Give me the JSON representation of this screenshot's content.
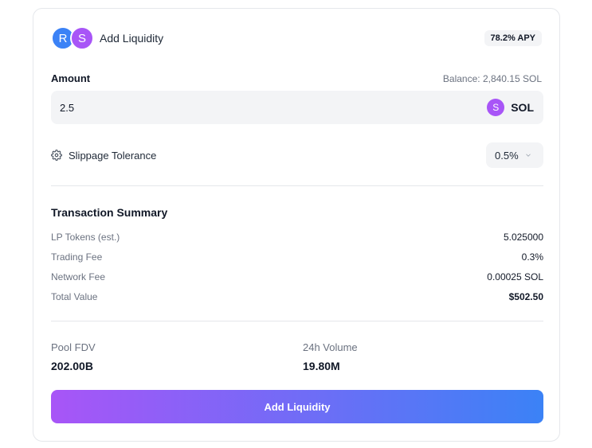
{
  "header": {
    "token_a_letter": "R",
    "token_b_letter": "S",
    "title": "Add Liquidity",
    "apy_badge": "78.2% APY",
    "token_a_color": "#3b82f6",
    "token_b_color": "#a855f7"
  },
  "amount": {
    "label": "Amount",
    "balance": "Balance: 2,840.15 SOL",
    "value": "2.5",
    "token_letter": "S",
    "token_symbol": "SOL"
  },
  "slippage": {
    "icon": "gear-icon",
    "label": "Slippage Tolerance",
    "selected": "0.5%",
    "dropdown_icon": "chevron-down-icon"
  },
  "summary": {
    "title": "Transaction Summary",
    "rows": [
      {
        "label": "LP Tokens (est.)",
        "value": "5.025000"
      },
      {
        "label": "Trading Fee",
        "value": "0.3%"
      },
      {
        "label": "Network Fee",
        "value": "0.00025 SOL"
      },
      {
        "label": "Total Value",
        "value": "$502.50"
      }
    ]
  },
  "stats": {
    "pool_fdv_label": "Pool FDV",
    "pool_fdv_value": "202.00B",
    "volume_label": "24h Volume",
    "volume_value": "19.80M"
  },
  "cta": {
    "label": "Add Liquidity",
    "gradient_start": "#a855f7",
    "gradient_end": "#3b82f6"
  }
}
